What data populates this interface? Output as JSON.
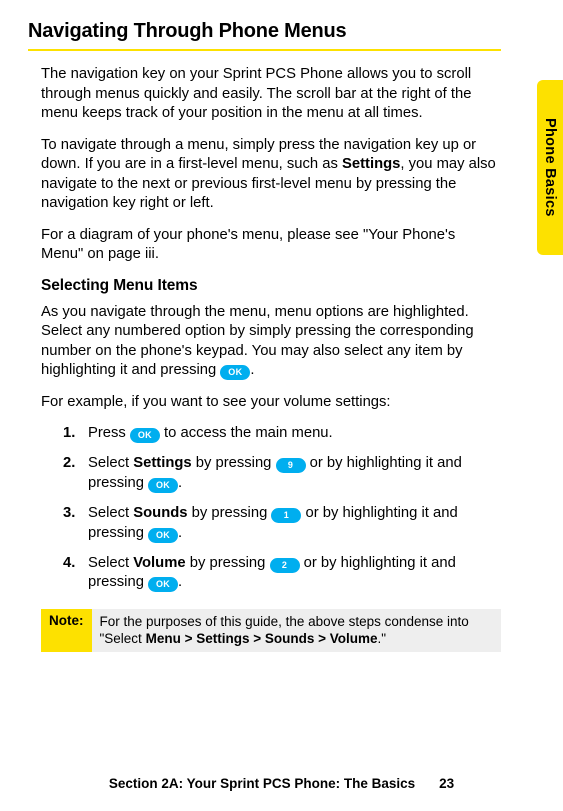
{
  "heading": "Navigating Through Phone Menus",
  "sideTab": "Phone Basics",
  "para1": "The navigation key on your Sprint PCS Phone allows you to scroll through menus quickly and easily. The scroll bar at the right of the menu keeps track of your position in the menu at all times.",
  "para2a": "To navigate through a menu, simply press the navigation key up or down. If you are in a first-level menu, such as ",
  "para2b": "Settings",
  "para2c": ", you may also navigate to the next or previous first-level menu by pressing the navigation key right or left.",
  "para3": "For a diagram of your phone's menu, please see \"Your Phone's Menu\" on page iii.",
  "subhead": "Selecting Menu Items",
  "para4a": "As you navigate through the menu, menu options are highlighted. Select any numbered option by simply pressing the corresponding number on the phone's keypad. You may also select any item by highlighting it and pressing ",
  "para4b": ".",
  "para5": "For example, if you want to see your volume settings:",
  "steps": [
    {
      "n": "1.",
      "a": "Press ",
      "k1": "OK",
      "b": " to access the main menu."
    },
    {
      "n": "2.",
      "a": "Select ",
      "bold1": "Settings",
      "b": " by pressing ",
      "k1": "9",
      "c": " or by highlighting it and pressing ",
      "k2": "OK",
      "d": "."
    },
    {
      "n": "3.",
      "a": "Select ",
      "bold1": "Sounds",
      "b": " by pressing ",
      "k1": "1",
      "c": " or by highlighting it and pressing ",
      "k2": "OK",
      "d": "."
    },
    {
      "n": "4.",
      "a": "Select ",
      "bold1": "Volume",
      "b": " by pressing ",
      "k1": "2",
      "c": " or by highlighting it and pressing ",
      "k2": "OK",
      "d": "."
    }
  ],
  "keyOK": "OK",
  "noteLabel": "Note:",
  "noteA": "For the purposes of this guide, the above steps condense into \"Select ",
  "noteB": "Menu > Settings > Sounds > Volume",
  "noteC": ".\"",
  "footerA": "Section 2A: Your Sprint PCS Phone: The Basics",
  "footerB": "23"
}
